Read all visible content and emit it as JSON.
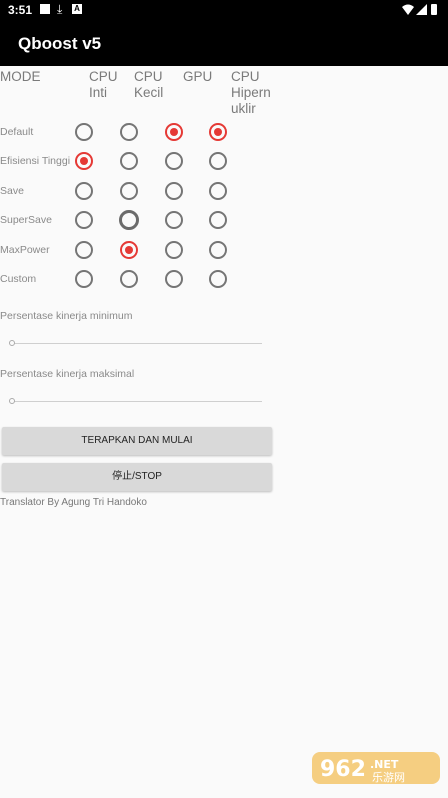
{
  "status_bar": {
    "time": "3:51",
    "left_icons": [
      "square-notification-icon",
      "download-icon",
      "auto-icon"
    ],
    "right_icons": [
      "wifi-icon",
      "signal-icon",
      "battery-icon"
    ]
  },
  "app_bar": {
    "title": "Qboost v5"
  },
  "table": {
    "mode_header": "MODE",
    "columns": [
      {
        "label": "CPU\nInti"
      },
      {
        "label": "CPU\nKecil"
      },
      {
        "label": "GPU"
      },
      {
        "label": "CPU\nHipern\nuklir"
      }
    ],
    "rows": [
      {
        "label": "Default",
        "checked": [
          false,
          false,
          true,
          true
        ]
      },
      {
        "label": "Efisiensi Tinggi",
        "checked": [
          true,
          false,
          false,
          false
        ]
      },
      {
        "label": "Save",
        "checked": [
          false,
          false,
          false,
          false
        ]
      },
      {
        "label": "SuperSave",
        "checked": [
          false,
          false,
          false,
          false
        ],
        "focused": 1
      },
      {
        "label": "MaxPower",
        "checked": [
          false,
          true,
          false,
          false
        ]
      },
      {
        "label": "Custom",
        "checked": [
          false,
          false,
          false,
          false
        ]
      }
    ]
  },
  "sliders": {
    "min_label": "Persentase kinerja minimum",
    "min_value": 0,
    "max_label": "Persentase kinerja maksimal",
    "max_value": 0
  },
  "buttons": {
    "apply_label": "TERAPKAN DAN MULAI",
    "stop_label": "停止/STOP"
  },
  "credit": "Translator By Agung Tri Handoko",
  "watermark": {
    "text": "962.NET",
    "subtext": "乐游网"
  },
  "colors": {
    "accent": "#e53935",
    "bar": "#000000",
    "background": "#fafafa",
    "button": "#d9d9d9"
  }
}
